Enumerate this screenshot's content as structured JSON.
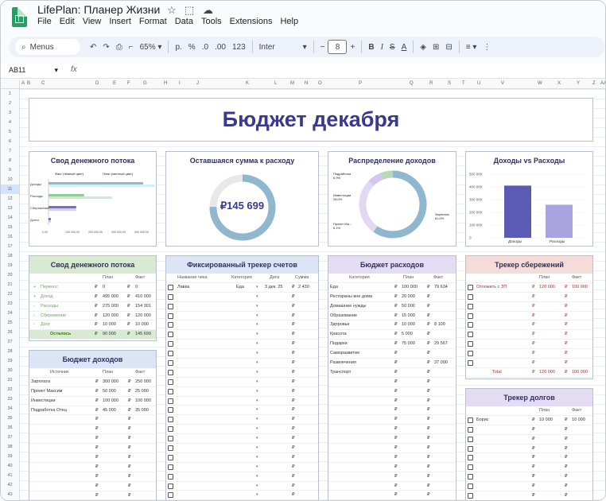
{
  "app": {
    "title": "LifePlan: Планер Жизни",
    "menu": [
      "File",
      "Edit",
      "View",
      "Insert",
      "Format",
      "Data",
      "Tools",
      "Extensions",
      "Help"
    ]
  },
  "toolbar": {
    "search": "Menus",
    "zoom": "65%",
    "currency": "р.",
    "percent": "%",
    "dec_less": ".0",
    "dec_more": ".00",
    "num_format": "123",
    "font": "Inter",
    "font_size": "8"
  },
  "formula_bar": {
    "cell": "AB11",
    "fx": "fx",
    "value": ""
  },
  "columns": [
    "A",
    "B",
    "C",
    "D",
    "E",
    "F",
    "G",
    "H",
    "I",
    "J",
    "K",
    "L",
    "M",
    "N",
    "O",
    "P",
    "Q",
    "R",
    "S",
    "T",
    "U",
    "V",
    "W",
    "X",
    "Y",
    "Z",
    "AA",
    "AB"
  ],
  "sheet_title": "Бюджет декабря",
  "cards": {
    "cashflow_chart": {
      "title": "Свод денежного потока",
      "legend_fact": "Факт (тёмный цвет)",
      "legend_plan": "План (светлый цвет)",
      "labels": [
        "Доходы",
        "Расходы",
        "Сбережения",
        "Долги"
      ],
      "ticks": [
        "0,00",
        "100 000,00",
        "200 000,00",
        "300 000,00",
        "400 000,00"
      ]
    },
    "remaining": {
      "title": "Оставшаяся сумма к расходу",
      "value": "₽145 699"
    },
    "income_dist": {
      "title": "Распределение доходов",
      "labels": [
        {
          "n": "Подработка",
          "p": "6,9%"
        },
        {
          "n": "Инвестиции",
          "p": "28,0%"
        },
        {
          "n": "Проект Ма...",
          "p": "6,1%"
        },
        {
          "n": "Зарплата",
          "p": "61,0%"
        }
      ]
    },
    "inc_vs_exp": {
      "title": "Доходы vs Расходы",
      "ticks": [
        "500 000",
        "400 000",
        "300 000",
        "200 000",
        "100 000",
        "0"
      ],
      "cats": [
        "Доходы",
        "Расходы"
      ]
    }
  },
  "chart_data": [
    {
      "type": "bar",
      "title": "Свод денежного потока",
      "categories": [
        "Доходы",
        "Расходы",
        "Сбережения",
        "Долги"
      ],
      "series": [
        {
          "name": "Факт (тёмный цвет)",
          "values": [
            410000,
            154301,
            120000,
            10000
          ]
        },
        {
          "name": "План (светлый цвет)",
          "values": [
            495000,
            275000,
            120000,
            10000
          ]
        }
      ],
      "xlim": [
        0,
        400000
      ]
    },
    {
      "type": "pie",
      "title": "Распределение доходов",
      "categories": [
        "Зарплата",
        "Инвестиции",
        "Подработка",
        "Проект Ма..."
      ],
      "values": [
        61.0,
        28.0,
        6.9,
        6.1
      ]
    },
    {
      "type": "bar",
      "title": "Доходы vs Расходы",
      "categories": [
        "Доходы",
        "Расходы"
      ],
      "values": [
        410000,
        260000
      ],
      "ylim": [
        0,
        500000
      ]
    }
  ],
  "cashflow": {
    "title": "Свод денежного потока",
    "hdr": [
      "План",
      "Факт"
    ],
    "rows": [
      {
        "s": "+",
        "n": "Перенос",
        "p": "0",
        "f": "0"
      },
      {
        "s": "+",
        "n": "Доход",
        "p": "495 000",
        "f": "410 000"
      },
      {
        "s": "-",
        "n": "Расходы",
        "p": "275 000",
        "f": "154 301"
      },
      {
        "s": "-",
        "n": "Сбережение",
        "p": "120 000",
        "f": "120 000"
      },
      {
        "s": "-",
        "n": "Долг",
        "p": "10 000",
        "f": "10 000"
      }
    ],
    "total": {
      "n": "Осталось",
      "p": "90 000",
      "f": "145 699"
    }
  },
  "income": {
    "title": "Бюджет доходов",
    "hdr": [
      "Источник",
      "План",
      "Факт"
    ],
    "rows": [
      {
        "n": "Зарплата",
        "p": "300 000",
        "f": "250 000"
      },
      {
        "n": "Проект Максим",
        "p": "50 000",
        "f": "25 000"
      },
      {
        "n": "Инвестиции",
        "p": "100 000",
        "f": "100 000"
      },
      {
        "n": "Подработка Отец",
        "p": "45 000",
        "f": "35 000"
      }
    ]
  },
  "bills": {
    "title": "Фиксированный трекер счетов",
    "hdr": [
      "Название чека",
      "Категория",
      "Дата",
      "Сумма"
    ],
    "first": {
      "n": "Лавка",
      "c": "Еда",
      "d": "3 дек. 25",
      "s": "2 430"
    }
  },
  "expenses": {
    "title": "Бюджет расходов",
    "hdr": [
      "Категория",
      "План",
      "Факт"
    ],
    "rows": [
      {
        "n": "Еда",
        "p": "100 000",
        "f": "79 634"
      },
      {
        "n": "Рестораны вне дома",
        "p": "20 000",
        "f": ""
      },
      {
        "n": "Домашние нужды",
        "p": "50 000",
        "f": ""
      },
      {
        "n": "Образование",
        "p": "15 000",
        "f": ""
      },
      {
        "n": "Здоровье",
        "p": "10 000",
        "f": "8 100"
      },
      {
        "n": "Красота",
        "p": "5 000",
        "f": ""
      },
      {
        "n": "Подарки",
        "p": "75 000",
        "f": "29 567"
      },
      {
        "n": "Саморазвитие",
        "p": "",
        "f": ""
      },
      {
        "n": "Развлечения",
        "p": "",
        "f": "37 000"
      },
      {
        "n": "Транспорт",
        "p": "",
        "f": ""
      }
    ]
  },
  "savings": {
    "title": "Трекер сбережений",
    "hdr": [
      "План",
      "Факт"
    ],
    "first": {
      "n": "Отложить с ЗП",
      "p": "120 000",
      "f": "100 000"
    },
    "total": {
      "n": "Total",
      "p": "120 000",
      "f": "100 000"
    }
  },
  "debts": {
    "title": "Трекер долгов",
    "hdr": [
      "План",
      "Факт"
    ],
    "first": {
      "n": "Борис",
      "p": "10 000",
      "f": "10 000"
    }
  },
  "currency": "₽",
  "colors": {
    "accent": "#3a3a8c",
    "green_head": "#d9ead3",
    "blue_head": "#dbe5f5",
    "purple_head": "#e4dcf2",
    "red_head": "#f5dcd8",
    "bar_dark": "#5b5bb5",
    "bar_light": "#a9a3e0"
  }
}
